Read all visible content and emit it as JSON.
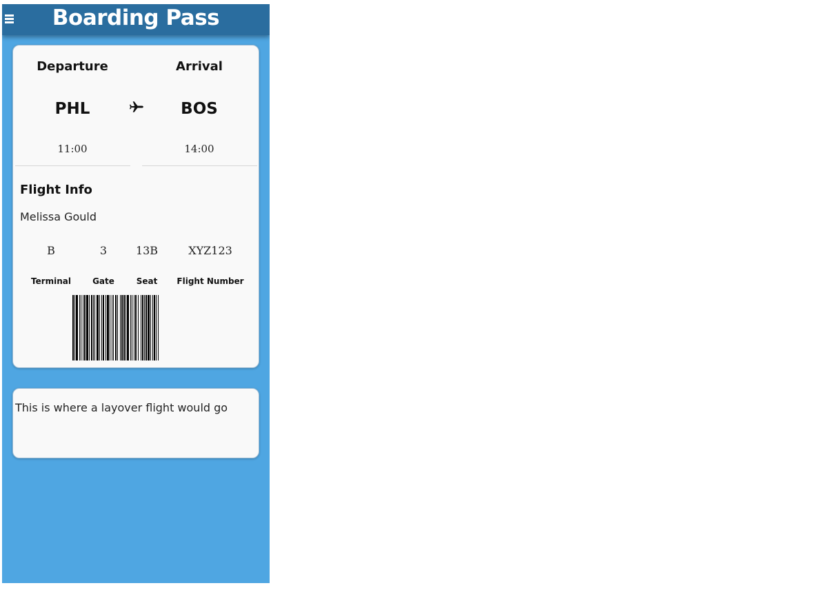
{
  "header": {
    "title": "Boarding Pass",
    "menu_icon": "hamburger-menu-icon"
  },
  "route": {
    "departure_label": "Departure",
    "arrival_label": "Arrival",
    "departure_code": "PHL",
    "arrival_code": "BOS",
    "departure_time": "11:00",
    "arrival_time": "14:00",
    "plane_icon": "airplane-icon"
  },
  "flight_info": {
    "title": "Flight Info",
    "passenger": "Melissa Gould",
    "terminal": "B",
    "gate": "3",
    "seat": "13B",
    "flight_number": "XYZ123",
    "terminal_label": "Terminal",
    "gate_label": "Gate",
    "seat_label": "Seat",
    "flight_number_label": "Flight Number"
  },
  "layover": {
    "text": "This is where a layover flight would go"
  },
  "colors": {
    "background": "#4fa6e2",
    "header": "#2a6d9f",
    "card": "#f9f9f9"
  }
}
